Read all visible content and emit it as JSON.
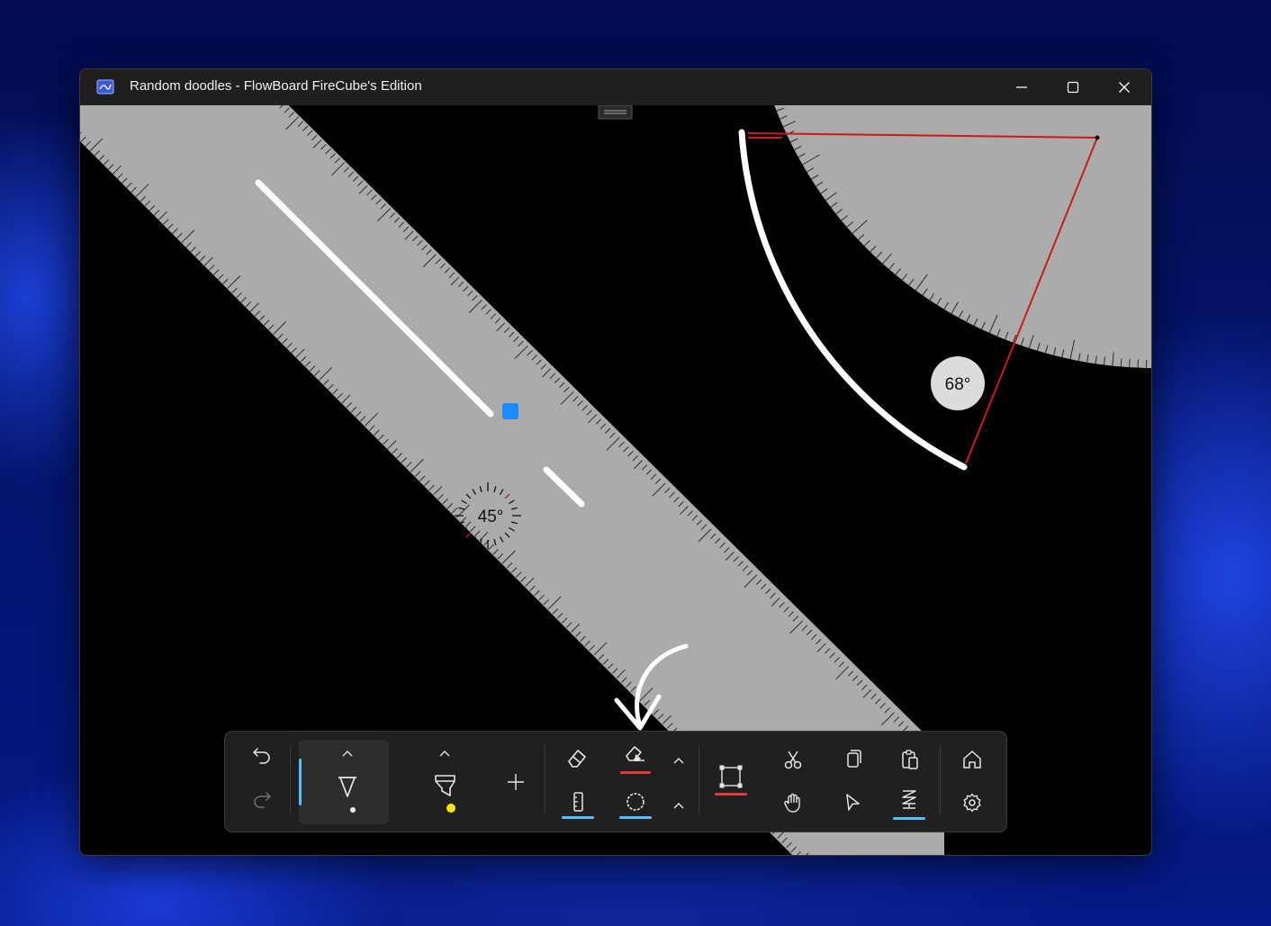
{
  "window": {
    "title": "Random doodles - FlowBoard FireCube's Edition",
    "controls": [
      "minimize-icon",
      "maximize-icon",
      "close-icon"
    ]
  },
  "canvas": {
    "background": "#000000",
    "ruler_angle_label": "45°",
    "protractor_angle_label": "68°",
    "selection_handle_color": "#1a8cff",
    "measure_line_color": "#cc1a1a"
  },
  "toolbar": {
    "history": [
      "undo-icon",
      "redo-icon"
    ],
    "pen": {
      "icon": "pen-icon",
      "dot_color": "#ffffff"
    },
    "highlighter": {
      "icon": "highlighter-icon",
      "dot_color": "#ffe600"
    },
    "add": "plus-icon",
    "tools": [
      "eraser-icon",
      "stroke-eraser-icon",
      "ruler-icon",
      "protractor-icon",
      "lasso-select-icon"
    ],
    "clipboard": [
      "cut-icon",
      "copy-icon",
      "paste-icon"
    ],
    "interaction": [
      "hand-icon",
      "pointer-icon",
      "scroll-icon"
    ],
    "app": [
      "home-icon",
      "settings-icon"
    ],
    "accent_blue": "#4fc3f7",
    "accent_red": "#e53935"
  }
}
